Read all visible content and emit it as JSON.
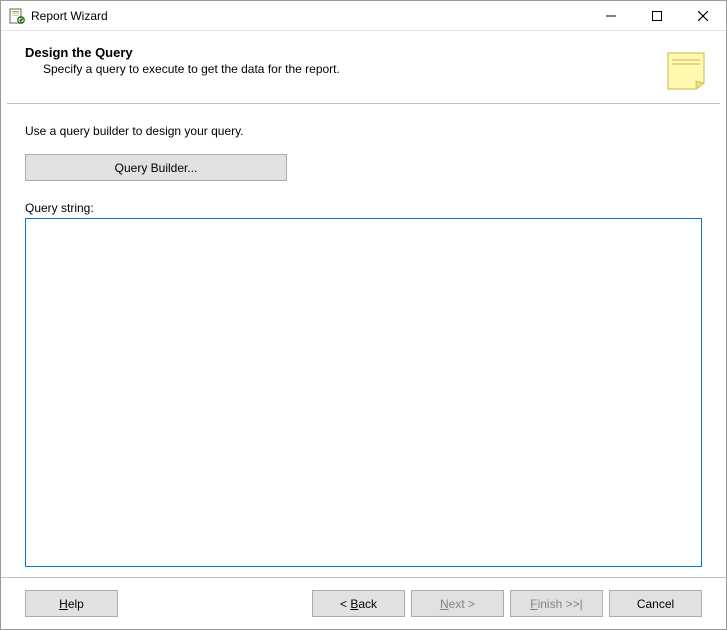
{
  "window": {
    "title": "Report Wizard"
  },
  "header": {
    "title": "Design the Query",
    "subtitle": "Specify a query to execute to get the data for the report."
  },
  "body": {
    "prompt": "Use a query builder to design your query.",
    "query_builder_label": "Query Builder...",
    "query_string_label": "Query string:",
    "query_string_value": ""
  },
  "footer": {
    "help": "Help",
    "back": "Back",
    "back_prefix": "< ",
    "next": "Next",
    "next_suffix": " >",
    "finish": "Finish",
    "finish_suffix": " >>|",
    "cancel": "Cancel"
  }
}
